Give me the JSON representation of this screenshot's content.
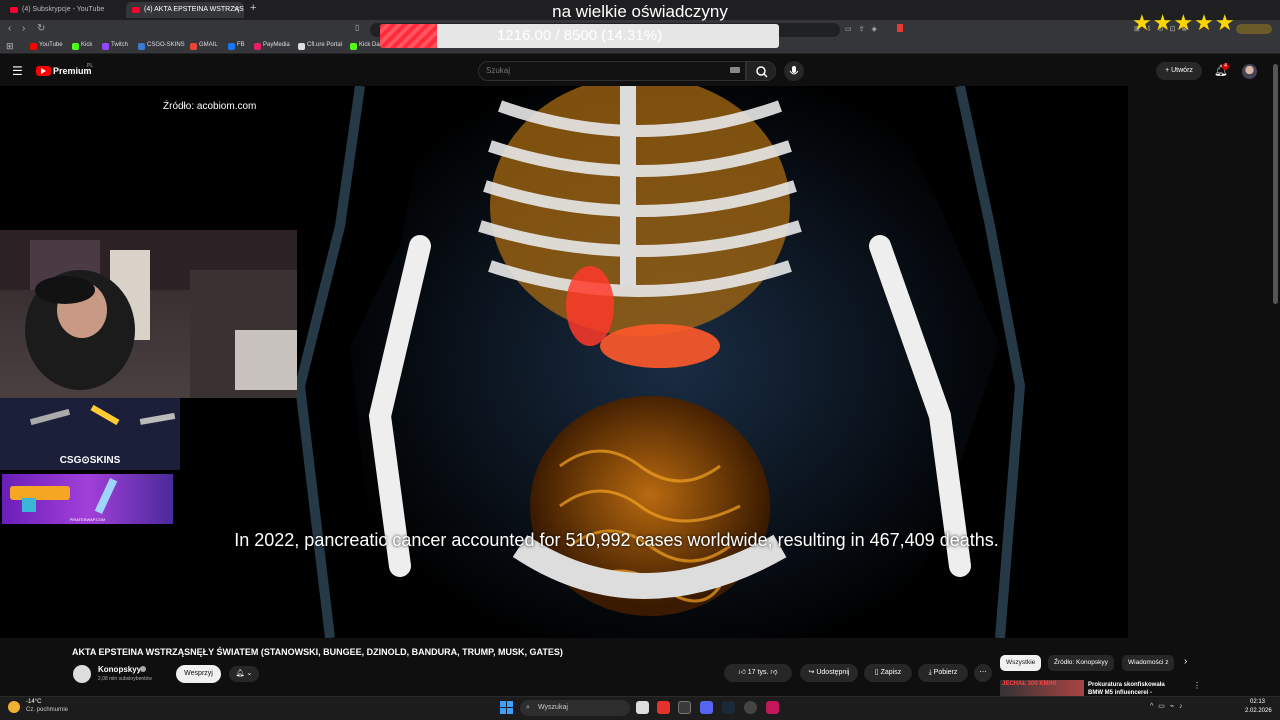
{
  "browser": {
    "tabs": [
      {
        "label": "(4) Subskrypcje - YouTube",
        "active": false
      },
      {
        "label": "(4) AKTA EPSTEINA WSTRZĄS",
        "active": true
      }
    ],
    "bookmarks": [
      "YouTube",
      "Kick",
      "Twitch",
      "CSGO-SKINS",
      "GMAIL",
      "FB",
      "PayMedia",
      "Cfl.ure Portal",
      "Kick Dashb..."
    ]
  },
  "overlay": {
    "title": "na wielkie oświadczyny",
    "goal_text": "1216.00 / 8500 (14.31%)",
    "goal_progress": 0.1431,
    "stars": "★★★★★"
  },
  "youtube": {
    "brand": "Premium",
    "brand_sup": "PL",
    "search_placeholder": "Szukaj",
    "create_label": "+ Utwórz",
    "notif_count": "4"
  },
  "video": {
    "source_label": "Źródło: acobiom.com",
    "subtitle": "In 2022, pancreatic cancer accounted for 510,992 cases worldwide, resulting in 467,409 deaths.",
    "ad_brand": "CSG⊙SKINS",
    "ad_banner_text": "PIRATESWAP.COM"
  },
  "meta": {
    "title": "AKTA EPSTEINA WSTRZĄSNĘŁY ŚWIATEM (STANOWSKI, BUNGEE, DZINOLD, BANDURA, TRUMP, MUSK, GATES)",
    "channel_name": "Konopskyy",
    "subscribers": "2,08 mln subskrybentów",
    "join_label": "Wesprzyj",
    "likes": "17 tys.",
    "share_label": "Udostępnij",
    "save_label": "Zapisz",
    "download_label": "Pobierz"
  },
  "chips": [
    "Wszystkie",
    "Źródło: Konopskyy",
    "Wiadomości z"
  ],
  "recommendation": {
    "thumb_text": "JECHAŁ 300 KM/H!",
    "title": "Prokuratura skonfiskowała BMW M5 influencerei -"
  },
  "taskbar": {
    "weather_temp": "-14°C",
    "weather_desc": "Cz. pochmurnie",
    "search_label": "Wyszukaj",
    "time": "02:13",
    "date": "2.02.2026"
  }
}
